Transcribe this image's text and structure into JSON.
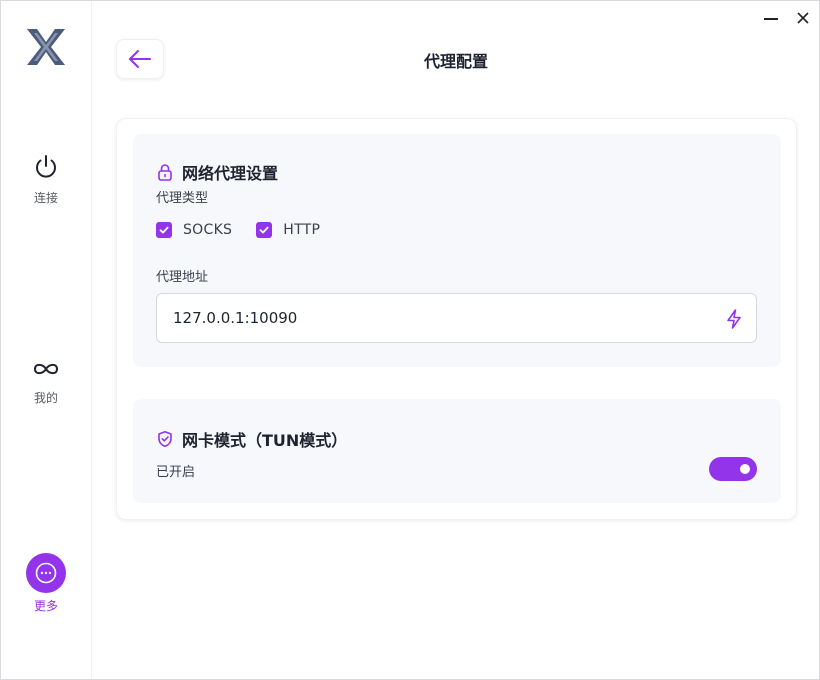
{
  "window": {
    "controls": {
      "minimize_icon": "minimize-icon",
      "close_icon": "close-icon"
    }
  },
  "sidebar": {
    "logo_icon": "x-logo",
    "items": [
      {
        "label": "连接",
        "icon": "power-icon"
      },
      {
        "label": "我的",
        "icon": "infinity-icon"
      },
      {
        "label": "更多",
        "icon": "more-dots-icon"
      }
    ]
  },
  "header": {
    "back_icon": "arrow-left-icon",
    "title": "代理配置"
  },
  "proxy_section": {
    "title": "网络代理设置",
    "icon": "lock-icon",
    "type_label": "代理类型",
    "types": [
      {
        "label": "SOCKS",
        "checked": true
      },
      {
        "label": "HTTP",
        "checked": true
      }
    ],
    "address_label": "代理地址",
    "address_value": "127.0.0.1:10090",
    "address_action_icon": "bolt-icon"
  },
  "tun_section": {
    "title": "网卡模式（TUN模式）",
    "icon": "shield-check-icon",
    "status": "已开启",
    "enabled": true
  },
  "colors": {
    "accent": "#9333ea",
    "logo": "#4b5b7d",
    "section_bg": "#f7f8fb"
  }
}
